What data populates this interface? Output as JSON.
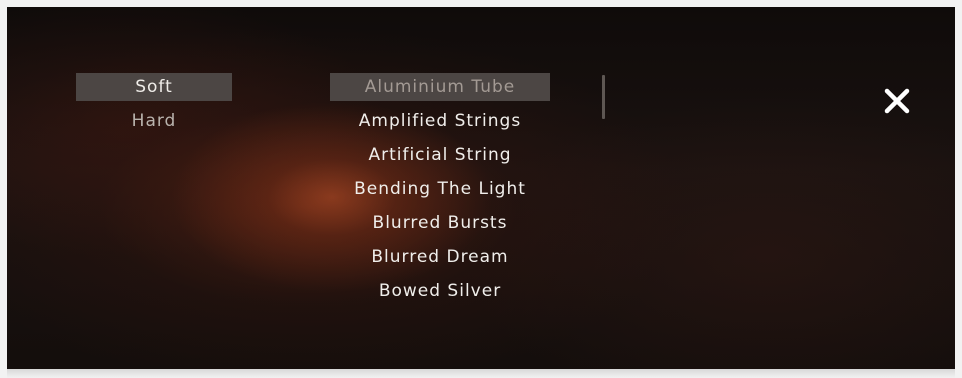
{
  "categories": {
    "selected_index": 0,
    "items": [
      "Soft",
      "Hard"
    ]
  },
  "presets": {
    "selected_index": 0,
    "items": [
      "Aluminium Tube",
      "Amplified Strings",
      "Artificial String",
      "Bending The Light",
      "Blurred Bursts",
      "Blurred Dream",
      "Bowed Silver"
    ]
  },
  "close": {
    "icon": "close-icon"
  },
  "colors": {
    "selected_bg": "#4c4644",
    "text": "#f0eeeb",
    "selected_preset_text": "#a39a94",
    "glow": "#c45228"
  }
}
